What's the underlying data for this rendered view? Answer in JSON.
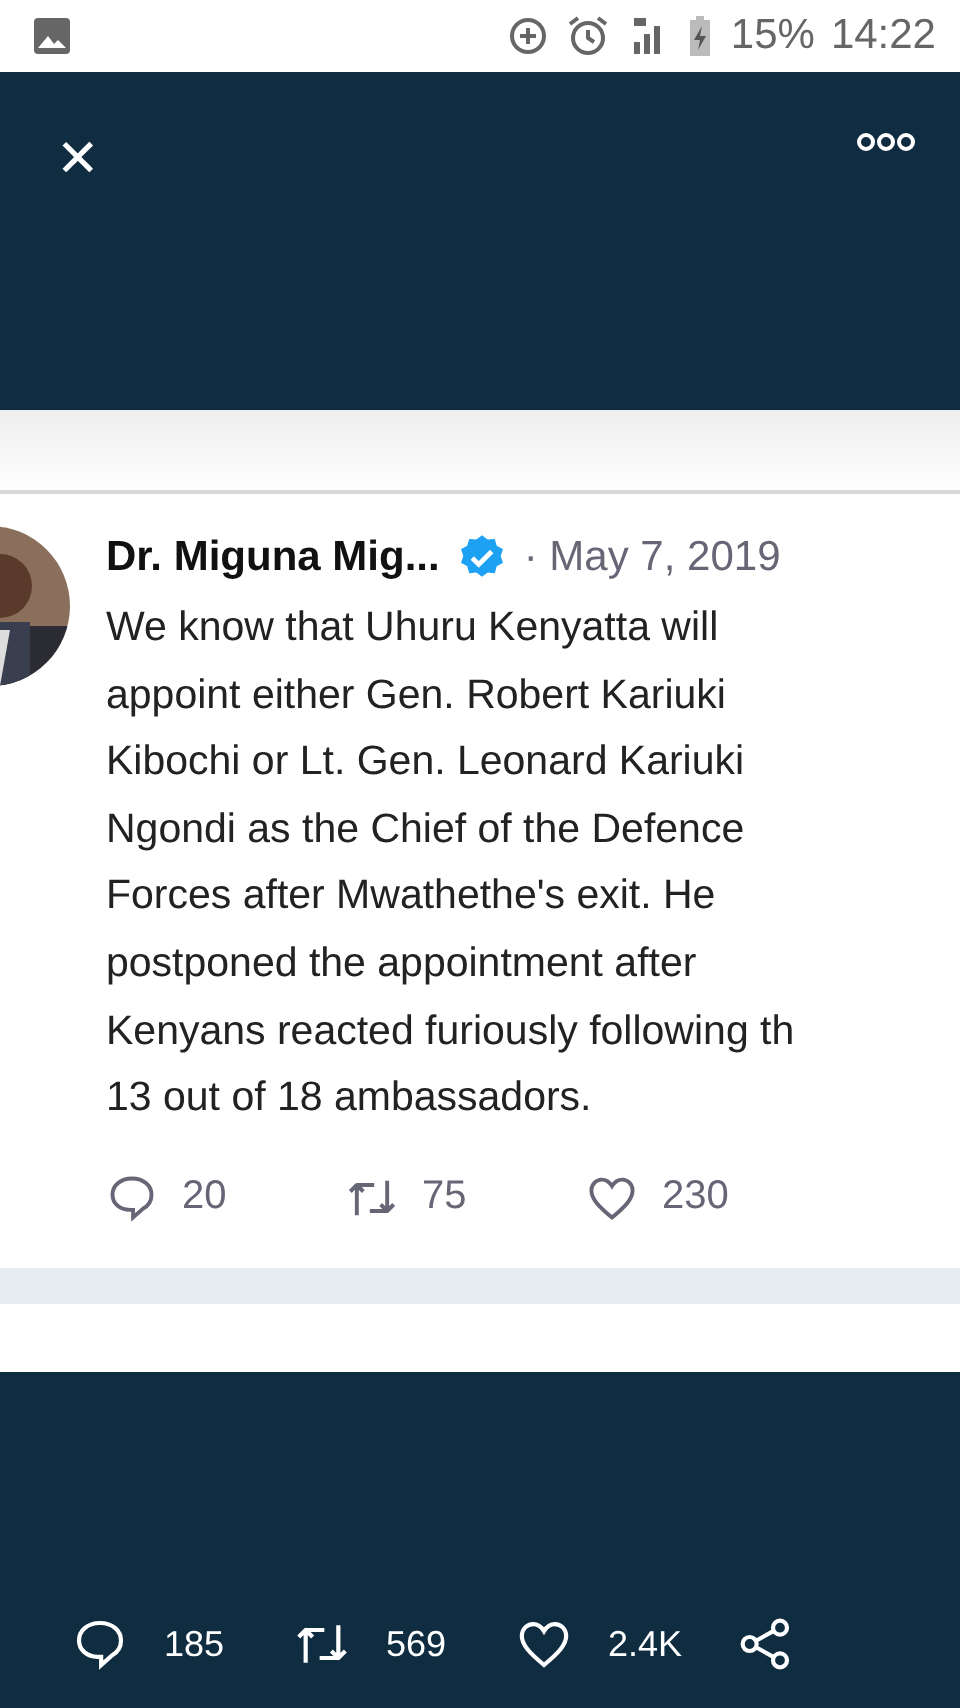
{
  "status_bar": {
    "battery": "15%",
    "time": "14:22"
  },
  "viewer_top_bar": {
    "close": "✕"
  },
  "tweet": {
    "author": "Dr. Miguna Mig...",
    "verified": true,
    "date": "· May 7, 2019",
    "text_lines": [
      "We know that Uhuru Kenyatta will",
      "appoint either Gen. Robert Kariuki",
      "Kibochi or Lt. Gen. Leonard Kariuki",
      "Ngondi as the Chief of the Defence",
      "Forces after Mwathethe's exit. He",
      "postponed the appointment after",
      "Kenyans reacted furiously following th",
      "13 out of 18 ambassadors."
    ],
    "actions": [
      {
        "kind": "reply",
        "count": "20"
      },
      {
        "kind": "retweet",
        "count": "75"
      },
      {
        "kind": "like",
        "count": "230"
      }
    ]
  },
  "viewer_bottom_bar": {
    "actions": [
      {
        "kind": "reply",
        "count": "185"
      },
      {
        "kind": "retweet",
        "count": "569"
      },
      {
        "kind": "like",
        "count": "2.4K"
      },
      {
        "kind": "share"
      }
    ]
  }
}
